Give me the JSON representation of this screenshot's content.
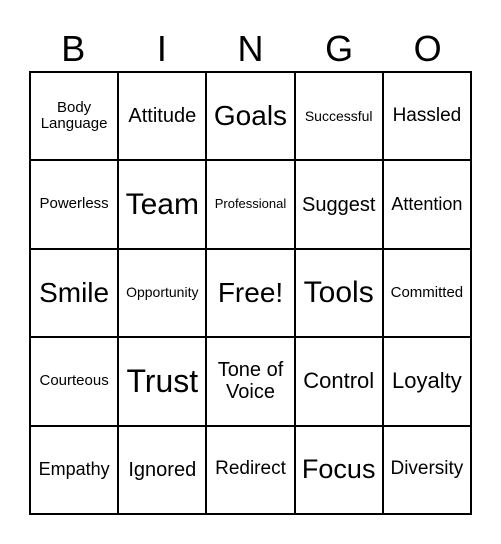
{
  "header": [
    "B",
    "I",
    "N",
    "G",
    "O"
  ],
  "cells": [
    [
      "Body Language",
      "Attitude",
      "Goals",
      "Successful",
      "Hassled"
    ],
    [
      "Powerless",
      "Team",
      "Professional",
      "Suggest",
      "Attention"
    ],
    [
      "Smile",
      "Opportunity",
      "Free!",
      "Tools",
      "Committed"
    ],
    [
      "Courteous",
      "Trust",
      "Tone of Voice",
      "Control",
      "Loyalty"
    ],
    [
      "Empathy",
      "Ignored",
      "Redirect",
      "Focus",
      "Diversity"
    ]
  ]
}
